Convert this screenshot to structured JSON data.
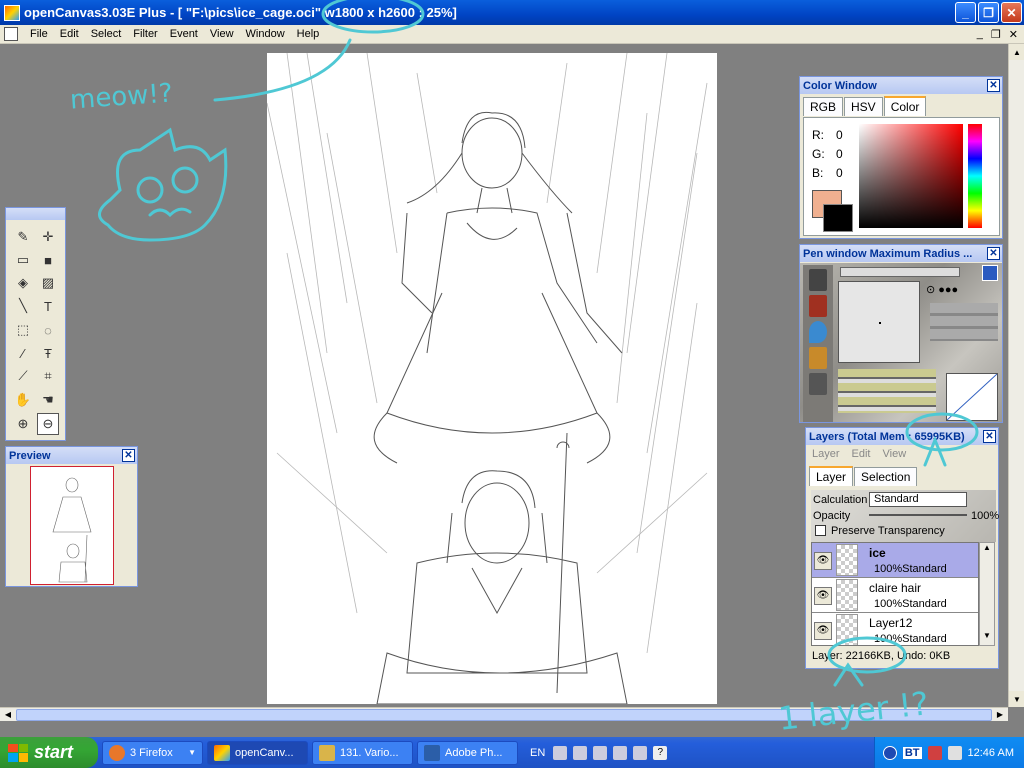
{
  "window": {
    "title": "openCanvas3.03E Plus - [ \"F:\\pics\\ice_cage.oci\" w1800 x h2600 : 25%]"
  },
  "menu": [
    "File",
    "Edit",
    "Select",
    "Filter",
    "Event",
    "View",
    "Window",
    "Help"
  ],
  "color_window": {
    "title": "Color Window",
    "tabs": [
      "RGB",
      "HSV",
      "Color"
    ],
    "active_tab": "Color",
    "r_label": "R:",
    "r": "0",
    "g_label": "G:",
    "g": "0",
    "b_label": "B:",
    "b": "0",
    "foreground": "#000000",
    "background": "#f0b090"
  },
  "pen_window": {
    "title": "Pen window  Maximum Radius ..."
  },
  "preview": {
    "title": "Preview"
  },
  "tools": [
    "pen-tool",
    "move-tool",
    "eraser-tool",
    "fill-rect-tool",
    "bucket-tool",
    "gradient-tool",
    "line-tool",
    "text-tool",
    "rect-select-tool",
    "lasso-tool",
    "magic-wand-tool",
    "text-select-tool",
    "eyedropper-tool",
    "crop-tool",
    "hand-tool",
    "rotate-hand-tool",
    "zoom-in-tool",
    "zoom-out-tool"
  ],
  "layers": {
    "title": "Layers (Total Mem : 65995KB)",
    "menu": [
      "Layer",
      "Edit",
      "View"
    ],
    "tabs": [
      "Layer",
      "Selection"
    ],
    "calculation_label": "Calculation",
    "calculation_value": "Standard",
    "opacity_label": "Opacity",
    "opacity_value": "100%",
    "preserve_label": "Preserve Transparency",
    "items": [
      {
        "name": "ice",
        "mode": "100%Standard",
        "selected": true
      },
      {
        "name": "claire hair",
        "mode": "100%Standard",
        "selected": false
      },
      {
        "name": "Layer12",
        "mode": "100%Standard",
        "selected": false
      }
    ],
    "status": "Layer: 22166KB, Undo: 0KB"
  },
  "annotations": {
    "meow": "meow!?",
    "one_layer": "1 layer !?"
  },
  "taskbar": {
    "start": "start",
    "items": [
      {
        "label": "3 Firefox",
        "color": "#e8772a"
      },
      {
        "label": "openCanv...",
        "color": "#ffcc33"
      },
      {
        "label": "131. Vario...",
        "color": "#d9b44a"
      },
      {
        "label": "Adobe Ph...",
        "color": "#2b5ea8"
      }
    ],
    "lang": "EN",
    "clock": "12:46 AM",
    "tray_label": "BT"
  }
}
